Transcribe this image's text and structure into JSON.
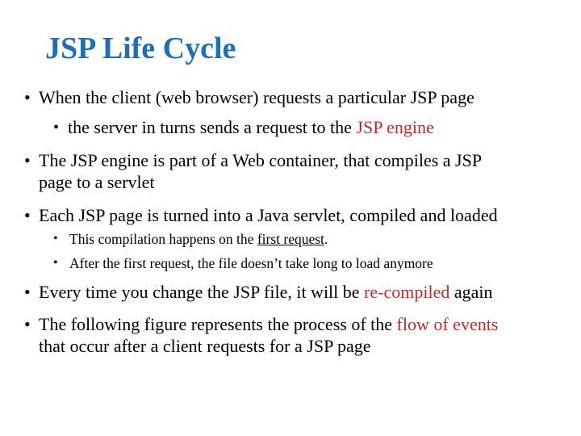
{
  "slide": {
    "title": "JSP Life Cycle",
    "bullet_glyph": "•",
    "items": [
      {
        "level": 1,
        "lines": [
          [
            {
              "text": "When the client (web browser) requests a particular JSP page",
              "style": "normal"
            }
          ]
        ]
      },
      {
        "level": 2,
        "lines": [
          [
            {
              "text": "the server in turns sends a request to the ",
              "style": "normal"
            },
            {
              "text": "JSP engine",
              "style": "red"
            }
          ]
        ]
      },
      {
        "level": 1,
        "lines": [
          [
            {
              "text": "The JSP engine is part of a Web container, that compiles a JSP",
              "style": "normal"
            }
          ],
          [
            {
              "text": "page to a servlet",
              "style": "normal"
            }
          ]
        ]
      },
      {
        "level": 1,
        "lines": [
          [
            {
              "text": "Each JSP page is turned into a Java servlet, compiled and loaded",
              "style": "normal"
            }
          ]
        ]
      },
      {
        "level": 3,
        "lines": [
          [
            {
              "text": "This compilation happens on the ",
              "style": "normal"
            },
            {
              "text": "first request",
              "style": "underline"
            },
            {
              "text": ".",
              "style": "normal"
            }
          ]
        ]
      },
      {
        "level": 3,
        "lines": [
          [
            {
              "text": "After the first request, the file doesn’t take long to load anymore",
              "style": "normal"
            }
          ]
        ]
      },
      {
        "level": 1,
        "lines": [
          [
            {
              "text": "Every time you change the JSP file, it will be ",
              "style": "normal"
            },
            {
              "text": "re-compiled",
              "style": "red"
            },
            {
              "text": " again",
              "style": "normal"
            }
          ]
        ]
      },
      {
        "level": 1,
        "lines": [
          [
            {
              "text": "The following figure represents the process of the ",
              "style": "normal"
            },
            {
              "text": "flow of events",
              "style": "red"
            }
          ],
          [
            {
              "text": "that occur after a client requests for a JSP page",
              "style": "normal"
            }
          ]
        ]
      }
    ]
  },
  "colors": {
    "title": "#1e6fb5",
    "highlight": "#c0282d",
    "text": "#000000",
    "background": "#ffffff"
  }
}
